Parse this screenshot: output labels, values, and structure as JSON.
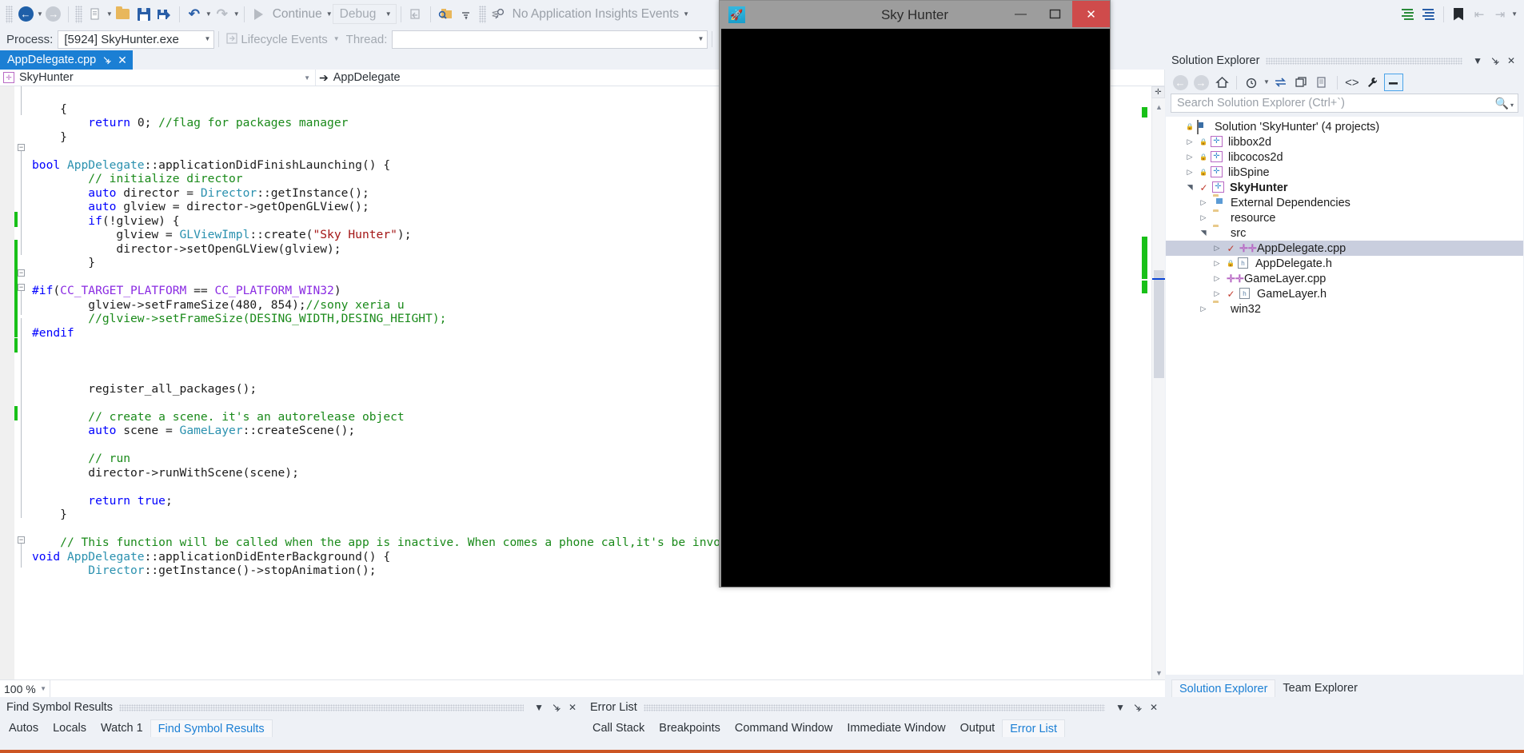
{
  "toolbar": {
    "continue_label": "Continue",
    "debug_config": "Debug",
    "insights_label": "No Application Insights Events",
    "nav_back_icon": "navigate-back-icon",
    "nav_forward_icon": "navigate-forward-icon",
    "new_item_icon": "new-item-icon",
    "open_file_icon": "open-file-icon",
    "save_icon": "save-icon",
    "save_all_icon": "save-all-icon",
    "undo_icon": "undo-icon",
    "redo_icon": "redo-icon",
    "start_icon": "start-debug-icon",
    "step_icon": "step-into-icon",
    "find_icon": "find-in-files-icon",
    "insights_icon": "app-insights-icon",
    "comment_icon": "comment-selection-icon",
    "uncomment_icon": "uncomment-selection-icon",
    "bookmark_icon": "bookmark-icon",
    "prev_bookmark_icon": "previous-bookmark-icon",
    "next_bookmark_icon": "next-bookmark-icon"
  },
  "process_bar": {
    "process_label": "Process:",
    "process_value": "[5924] SkyHunter.exe",
    "lifecycle_label": "Lifecycle Events",
    "thread_label": "Thread:",
    "thread_value": "",
    "stack_frame_icon": "stack-frame-icon"
  },
  "editor": {
    "tab_title": "AppDelegate.cpp",
    "pin_icon": "pin-icon",
    "close_icon": "close-icon",
    "scope_combo": "SkyHunter",
    "member_combo": "AppDelegate",
    "zoom_level": "100 %",
    "code_lines": [
      {
        "indent": 1,
        "parts": [
          {
            "t": "{",
            "c": ""
          }
        ]
      },
      {
        "indent": 2,
        "parts": [
          {
            "t": "return ",
            "c": "kw"
          },
          {
            "t": "0; ",
            "c": ""
          },
          {
            "t": "//flag for packages manager",
            "c": "cm"
          }
        ]
      },
      {
        "indent": 1,
        "parts": [
          {
            "t": "}",
            "c": ""
          }
        ]
      },
      {
        "indent": 0,
        "parts": [
          {
            "t": "",
            "c": ""
          }
        ]
      },
      {
        "indent": 0,
        "parts": [
          {
            "t": "bool ",
            "c": "kw"
          },
          {
            "t": "AppDelegate",
            "c": "ty"
          },
          {
            "t": "::applicationDidFinishLaunching() {",
            "c": ""
          }
        ]
      },
      {
        "indent": 2,
        "parts": [
          {
            "t": "// initialize director",
            "c": "cm"
          }
        ]
      },
      {
        "indent": 2,
        "parts": [
          {
            "t": "auto ",
            "c": "kw"
          },
          {
            "t": "director = ",
            "c": ""
          },
          {
            "t": "Director",
            "c": "ty"
          },
          {
            "t": "::getInstance();",
            "c": ""
          }
        ]
      },
      {
        "indent": 2,
        "parts": [
          {
            "t": "auto ",
            "c": "kw"
          },
          {
            "t": "glview = director->getOpenGLView();",
            "c": ""
          }
        ]
      },
      {
        "indent": 2,
        "parts": [
          {
            "t": "if",
            "c": "kw"
          },
          {
            "t": "(!glview) {",
            "c": ""
          }
        ]
      },
      {
        "indent": 3,
        "parts": [
          {
            "t": "glview = ",
            "c": ""
          },
          {
            "t": "GLViewImpl",
            "c": "ty"
          },
          {
            "t": "::create(",
            "c": ""
          },
          {
            "t": "\"Sky Hunter\"",
            "c": "st"
          },
          {
            "t": ");",
            "c": ""
          }
        ]
      },
      {
        "indent": 3,
        "parts": [
          {
            "t": "director->setOpenGLView(glview);",
            "c": ""
          }
        ]
      },
      {
        "indent": 2,
        "parts": [
          {
            "t": "}",
            "c": ""
          }
        ]
      },
      {
        "indent": 0,
        "parts": [
          {
            "t": "",
            "c": ""
          }
        ]
      },
      {
        "indent": 0,
        "parts": [
          {
            "t": "#if",
            "c": "kw"
          },
          {
            "t": "(",
            "c": ""
          },
          {
            "t": "CC_TARGET_PLATFORM",
            "c": "pp"
          },
          {
            "t": " == ",
            "c": ""
          },
          {
            "t": "CC_PLATFORM_WIN32",
            "c": "pp"
          },
          {
            "t": ")",
            "c": ""
          }
        ]
      },
      {
        "indent": 2,
        "parts": [
          {
            "t": "glview->setFrameSize(480, 854);",
            "c": ""
          },
          {
            "t": "//sony xeria u",
            "c": "cm"
          }
        ]
      },
      {
        "indent": 2,
        "parts": [
          {
            "t": "//glview->setFrameSize(DESING_WIDTH,DESING_HEIGHT);",
            "c": "cm"
          }
        ]
      },
      {
        "indent": 0,
        "parts": [
          {
            "t": "#endif",
            "c": "kw"
          }
        ]
      },
      {
        "indent": 0,
        "parts": [
          {
            "t": "",
            "c": ""
          }
        ]
      },
      {
        "indent": 0,
        "parts": [
          {
            "t": "",
            "c": ""
          }
        ]
      },
      {
        "indent": 0,
        "parts": [
          {
            "t": "",
            "c": ""
          }
        ]
      },
      {
        "indent": 2,
        "parts": [
          {
            "t": "register_all_packages();",
            "c": ""
          }
        ]
      },
      {
        "indent": 0,
        "parts": [
          {
            "t": "",
            "c": ""
          }
        ]
      },
      {
        "indent": 2,
        "parts": [
          {
            "t": "// create a scene. it's an autorelease object",
            "c": "cm"
          }
        ]
      },
      {
        "indent": 2,
        "parts": [
          {
            "t": "auto ",
            "c": "kw"
          },
          {
            "t": "scene = ",
            "c": ""
          },
          {
            "t": "GameLayer",
            "c": "ty"
          },
          {
            "t": "::createScene();",
            "c": ""
          }
        ]
      },
      {
        "indent": 0,
        "parts": [
          {
            "t": "",
            "c": ""
          }
        ]
      },
      {
        "indent": 2,
        "parts": [
          {
            "t": "// run",
            "c": "cm"
          }
        ]
      },
      {
        "indent": 2,
        "parts": [
          {
            "t": "director->runWithScene(scene);",
            "c": ""
          }
        ]
      },
      {
        "indent": 0,
        "parts": [
          {
            "t": "",
            "c": ""
          }
        ]
      },
      {
        "indent": 2,
        "parts": [
          {
            "t": "return ",
            "c": "kw"
          },
          {
            "t": "true",
            "c": "kw"
          },
          {
            "t": ";",
            "c": ""
          }
        ]
      },
      {
        "indent": 1,
        "parts": [
          {
            "t": "}",
            "c": ""
          }
        ]
      },
      {
        "indent": 0,
        "parts": [
          {
            "t": "",
            "c": ""
          }
        ]
      },
      {
        "indent": 1,
        "parts": [
          {
            "t": "// This function will be called when the app is inactive. When comes a phone call,it's be invok",
            "c": "cm"
          }
        ]
      },
      {
        "indent": 0,
        "parts": [
          {
            "t": "void ",
            "c": "kw"
          },
          {
            "t": "AppDelegate",
            "c": "ty"
          },
          {
            "t": "::applicationDidEnterBackground() {",
            "c": ""
          }
        ]
      },
      {
        "indent": 2,
        "parts": [
          {
            "t": "Director",
            "c": "ty"
          },
          {
            "t": "::getInstance()->stopAnimation();",
            "c": ""
          }
        ]
      }
    ]
  },
  "bottom_left_panel": {
    "title": "Find Symbol Results",
    "dropdown_icon": "chevron-down-icon",
    "pin_icon": "pin-icon",
    "close_icon": "close-icon",
    "tabs": [
      "Autos",
      "Locals",
      "Watch 1",
      "Find Symbol Results"
    ],
    "active_tab": "Find Symbol Results"
  },
  "bottom_right_panel": {
    "title": "Error List",
    "dropdown_icon": "chevron-down-icon",
    "pin_icon": "pin-icon",
    "close_icon": "close-icon",
    "tabs": [
      "Call Stack",
      "Breakpoints",
      "Command Window",
      "Immediate Window",
      "Output",
      "Error List"
    ],
    "active_tab": "Error List"
  },
  "solution_explorer": {
    "title": "Solution Explorer",
    "dropdown_icon": "chevron-down-icon",
    "pin_icon": "pin-icon",
    "close_icon": "close-icon",
    "search_placeholder": "Search Solution Explorer (Ctrl+`)",
    "search_icon": "search-icon",
    "toolbar_icons": [
      "back-icon",
      "forward-icon",
      "home-icon",
      "pending-changes-icon",
      "sync-with-active-document-icon",
      "refresh-icon",
      "collapse-all-icon",
      "show-all-files-icon",
      "properties-icon",
      "preview-selected-items-icon"
    ],
    "tree": [
      {
        "depth": 0,
        "twisty": "",
        "icon": "solution-icon",
        "label": "Solution 'SkyHunter' (4 projects)",
        "bold": false,
        "lock": true,
        "check": false,
        "selected": false
      },
      {
        "depth": 1,
        "twisty": "collapsed",
        "icon": "project-icon",
        "label": "libbox2d",
        "bold": false,
        "lock": true,
        "check": false,
        "selected": false
      },
      {
        "depth": 1,
        "twisty": "collapsed",
        "icon": "project-icon",
        "label": "libcocos2d",
        "bold": false,
        "lock": true,
        "check": false,
        "selected": false
      },
      {
        "depth": 1,
        "twisty": "collapsed",
        "icon": "project-icon",
        "label": "libSpine",
        "bold": false,
        "lock": true,
        "check": false,
        "selected": false
      },
      {
        "depth": 1,
        "twisty": "expanded",
        "icon": "project-icon",
        "label": "SkyHunter",
        "bold": true,
        "lock": false,
        "check": true,
        "selected": false
      },
      {
        "depth": 2,
        "twisty": "collapsed",
        "icon": "dependencies-folder-icon",
        "label": "External Dependencies",
        "bold": false,
        "lock": false,
        "check": false,
        "selected": false
      },
      {
        "depth": 2,
        "twisty": "collapsed",
        "icon": "folder-icon",
        "label": "resource",
        "bold": false,
        "lock": false,
        "check": false,
        "selected": false
      },
      {
        "depth": 2,
        "twisty": "expanded",
        "icon": "folder-icon",
        "label": "src",
        "bold": false,
        "lock": false,
        "check": false,
        "selected": false
      },
      {
        "depth": 3,
        "twisty": "collapsed",
        "icon": "cpp-file-icon",
        "label": "AppDelegate.cpp",
        "bold": false,
        "lock": false,
        "check": true,
        "selected": true
      },
      {
        "depth": 3,
        "twisty": "collapsed",
        "icon": "header-file-icon",
        "label": "AppDelegate.h",
        "bold": false,
        "lock": true,
        "check": false,
        "selected": false
      },
      {
        "depth": 3,
        "twisty": "collapsed",
        "icon": "cpp-file-icon",
        "label": "GameLayer.cpp",
        "bold": false,
        "lock": false,
        "check": false,
        "selected": false
      },
      {
        "depth": 3,
        "twisty": "collapsed",
        "icon": "header-file-icon",
        "label": "GameLayer.h",
        "bold": false,
        "lock": false,
        "check": true,
        "selected": false
      },
      {
        "depth": 2,
        "twisty": "collapsed",
        "icon": "folder-icon",
        "label": "win32",
        "bold": false,
        "lock": false,
        "check": false,
        "selected": false
      }
    ],
    "tabs": [
      "Solution Explorer",
      "Team Explorer"
    ],
    "active_tab": "Solution Explorer"
  },
  "game_window": {
    "title": "Sky Hunter",
    "app_icon": "sky-hunter-app-icon",
    "minimize_icon": "minimize-icon",
    "maximize_icon": "maximize-icon",
    "close_icon": "close-icon",
    "canvas_color": "#000000",
    "close_button_color": "#cf4b4b"
  }
}
